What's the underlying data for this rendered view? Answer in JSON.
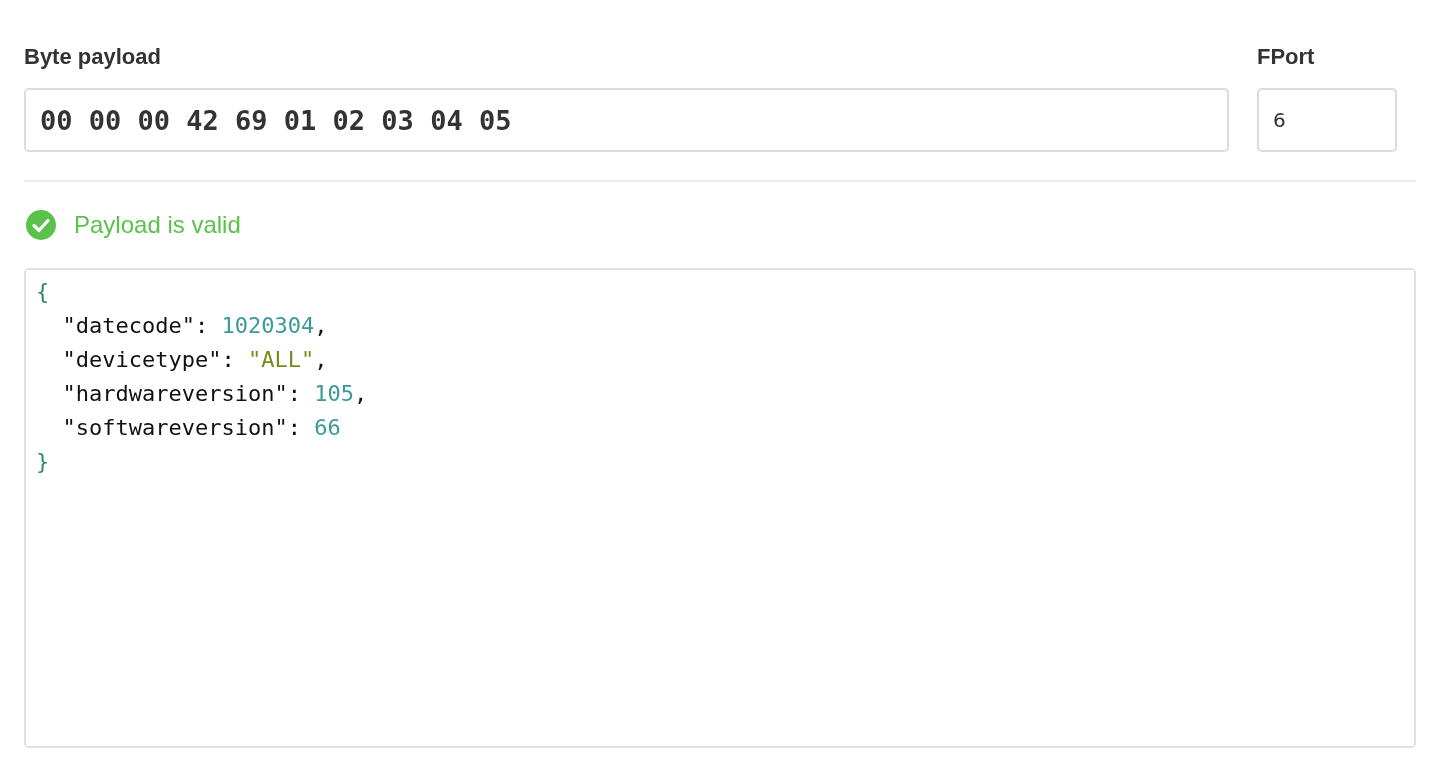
{
  "payload": {
    "label": "Byte payload",
    "value": "00 00 00 42 69 01 02 03 04 05"
  },
  "fport": {
    "label": "FPort",
    "value": "6"
  },
  "status": {
    "valid": true,
    "message": "Payload is valid"
  },
  "output": {
    "open": "{",
    "close": "}",
    "entries": [
      [
        {
          "kind": "key",
          "text": "\"datecode\""
        },
        {
          "kind": "punct",
          "text": ": "
        },
        {
          "kind": "number",
          "text": "1020304"
        },
        {
          "kind": "punct",
          "text": ","
        }
      ],
      [
        {
          "kind": "key",
          "text": "\"devicetype\""
        },
        {
          "kind": "punct",
          "text": ": "
        },
        {
          "kind": "string",
          "text": "\"ALL\""
        },
        {
          "kind": "punct",
          "text": ","
        }
      ],
      [
        {
          "kind": "key",
          "text": "\"hardwareversion\""
        },
        {
          "kind": "punct",
          "text": ": "
        },
        {
          "kind": "number",
          "text": "105"
        },
        {
          "kind": "punct",
          "text": ","
        }
      ],
      [
        {
          "kind": "key",
          "text": "\"softwareversion\""
        },
        {
          "kind": "punct",
          "text": ": "
        },
        {
          "kind": "number",
          "text": "66"
        }
      ]
    ]
  }
}
